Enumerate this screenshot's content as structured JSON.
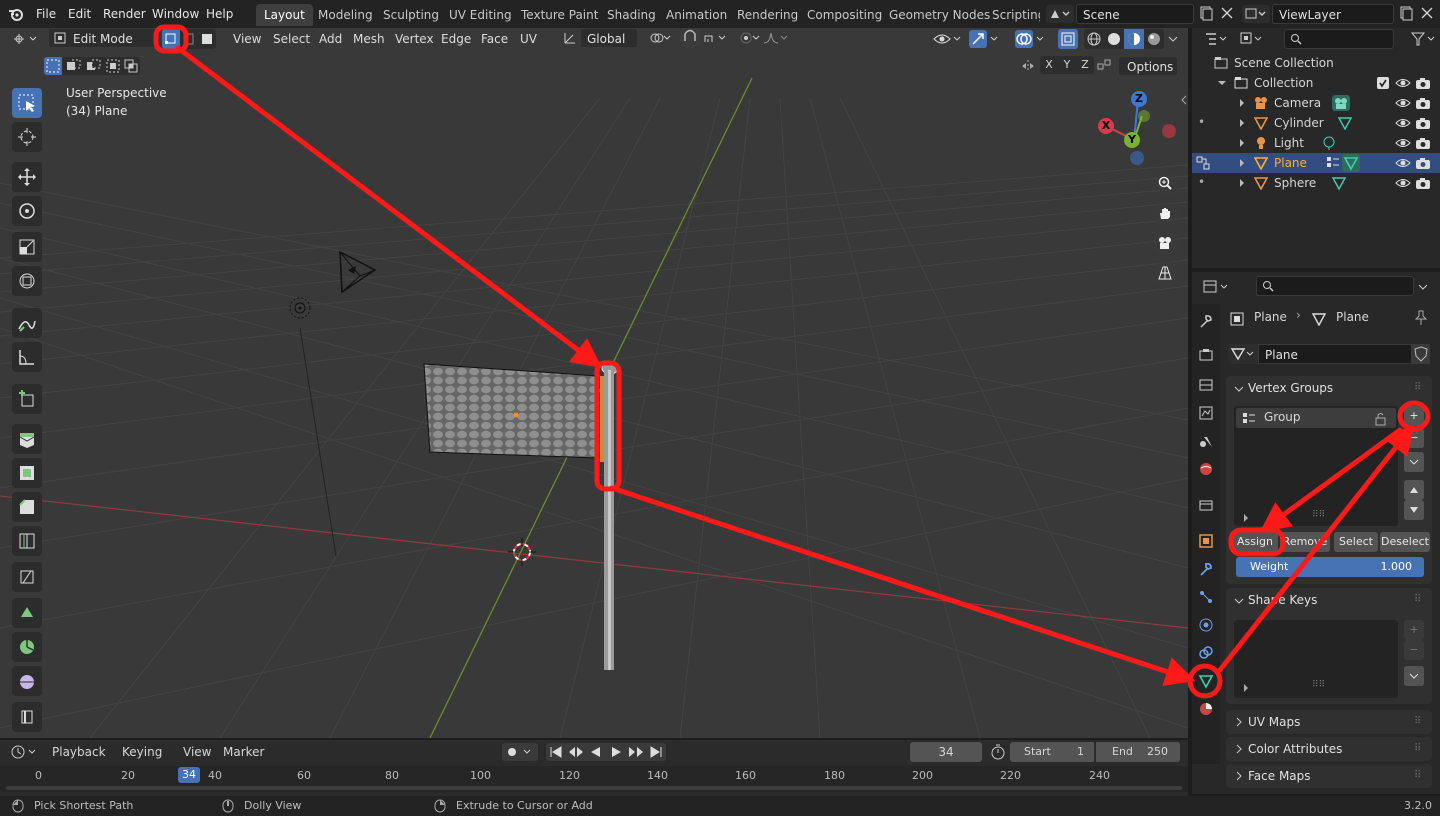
{
  "menu": [
    "File",
    "Edit",
    "Render",
    "Window",
    "Help"
  ],
  "workspaces": [
    "Layout",
    "Modeling",
    "Sculpting",
    "UV Editing",
    "Texture Paint",
    "Shading",
    "Animation",
    "Rendering",
    "Compositing",
    "Geometry Nodes",
    "Scripting"
  ],
  "scene": "Scene",
  "view_layer": "ViewLayer",
  "viewport_header": {
    "mode": "Edit Mode",
    "menus": [
      "View",
      "Select",
      "Add",
      "Mesh",
      "Vertex",
      "Edge",
      "Face",
      "UV"
    ],
    "transform": "Global",
    "options": "Options",
    "axes": [
      "X",
      "Y",
      "Z"
    ]
  },
  "viewport_info": {
    "perspective": "User Perspective",
    "object": "(34) Plane"
  },
  "gizmo": {
    "z": "Z",
    "x": "X",
    "y": "Y"
  },
  "outliner": {
    "root": "Scene Collection",
    "collection": "Collection",
    "items": [
      "Camera",
      "Cylinder",
      "Light",
      "Plane",
      "Sphere"
    ],
    "selected": "Plane"
  },
  "properties": {
    "breadcrumb_object": "Plane",
    "breadcrumb_data": "Plane",
    "data_name": "Plane",
    "vertex_groups_title": "Vertex Groups",
    "group_name": "Group",
    "assign": "Assign",
    "remove": "Remove",
    "select": "Select",
    "deselect": "Deselect",
    "weight_label": "Weight",
    "weight_value": "1.000",
    "shape_keys": "Shape Keys",
    "uv_maps": "UV Maps",
    "color_attributes": "Color Attributes",
    "face_maps": "Face Maps"
  },
  "timeline": {
    "menus": [
      "Playback",
      "Keying",
      "View",
      "Marker"
    ],
    "current_frame": "34",
    "start_label": "Start",
    "start": "1",
    "end_label": "End",
    "end": "250",
    "ticks": [
      "0",
      "20",
      "40",
      "60",
      "80",
      "100",
      "120",
      "140",
      "160",
      "180",
      "200",
      "220",
      "240"
    ]
  },
  "status": {
    "left": "Pick Shortest Path",
    "middle": "Dolly View",
    "right": "Extrude to Cursor or Add",
    "version": "3.2.0"
  },
  "colors": {
    "accent": "#4772b3",
    "annotation": "#ff1a1a",
    "selected_text": "#ffaf29"
  }
}
